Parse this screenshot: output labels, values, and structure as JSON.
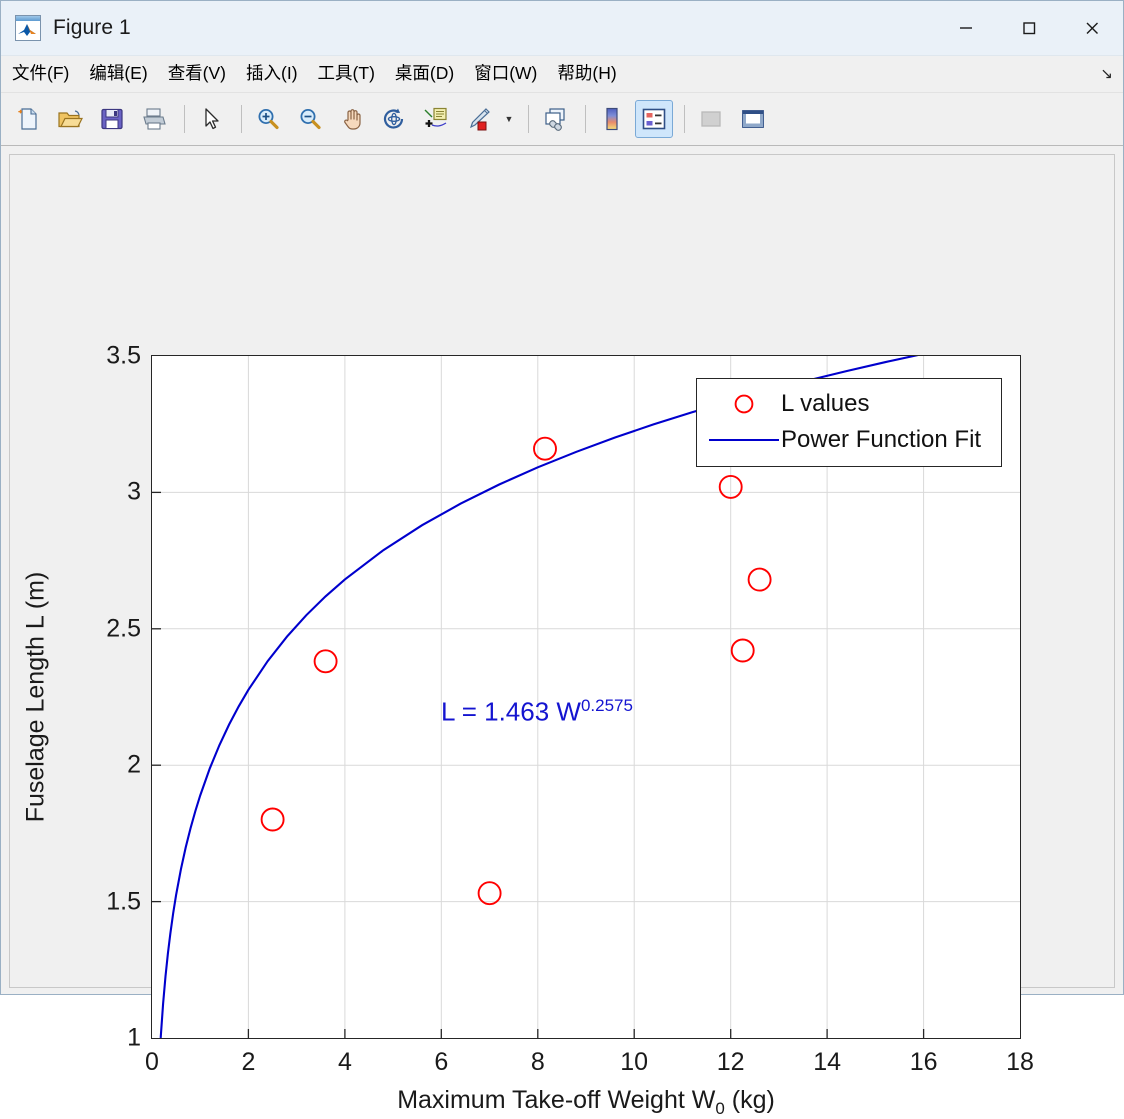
{
  "window": {
    "title": "Figure 1",
    "app_icon": "matlab-logo-icon",
    "minimize_label": "—",
    "maximize_label": "□",
    "close_label": "✕"
  },
  "menubar": {
    "items": [
      {
        "label": "文件(F)",
        "mnemonic": "F",
        "name": "menu-file"
      },
      {
        "label": "编辑(E)",
        "mnemonic": "E",
        "name": "menu-edit"
      },
      {
        "label": "查看(V)",
        "mnemonic": "V",
        "name": "menu-view"
      },
      {
        "label": "插入(I)",
        "mnemonic": "I",
        "name": "menu-insert"
      },
      {
        "label": "工具(T)",
        "mnemonic": "T",
        "name": "menu-tools"
      },
      {
        "label": "桌面(D)",
        "mnemonic": "D",
        "name": "menu-desktop"
      },
      {
        "label": "窗口(W)",
        "mnemonic": "W",
        "name": "menu-window"
      },
      {
        "label": "帮助(H)",
        "mnemonic": "H",
        "name": "menu-help"
      }
    ],
    "overflow_label": "↘"
  },
  "toolbar": {
    "buttons": [
      {
        "name": "new-figure-icon",
        "tooltip": "New Figure"
      },
      {
        "name": "open-file-icon",
        "tooltip": "Open File"
      },
      {
        "name": "save-figure-icon",
        "tooltip": "Save Figure"
      },
      {
        "name": "print-figure-icon",
        "tooltip": "Print Figure"
      },
      {
        "name": "pointer-icon",
        "tooltip": "Edit Plot"
      },
      {
        "name": "zoom-in-icon",
        "tooltip": "Zoom In"
      },
      {
        "name": "zoom-out-icon",
        "tooltip": "Zoom Out"
      },
      {
        "name": "pan-icon",
        "tooltip": "Pan"
      },
      {
        "name": "rotate-3d-icon",
        "tooltip": "Rotate 3D"
      },
      {
        "name": "data-cursor-icon",
        "tooltip": "Data Cursor"
      },
      {
        "name": "brush-icon",
        "tooltip": "Brush/Select Data"
      },
      {
        "name": "link-plot-icon",
        "tooltip": "Link Plot"
      },
      {
        "name": "colorbar-icon",
        "tooltip": "Insert Colorbar"
      },
      {
        "name": "legend-icon",
        "tooltip": "Insert Legend",
        "active": true
      },
      {
        "name": "hide-plot-tools-icon",
        "tooltip": "Hide Plot Tools",
        "disabled": true
      },
      {
        "name": "show-plot-tools-icon",
        "tooltip": "Show Plot Tools and Dock Figure"
      }
    ]
  },
  "chart_data": {
    "type": "scatter",
    "title": "",
    "xlabel": "Maximum Take-off Weight W_0 (kg)",
    "xlabel_main": "Maximum Take-off Weight W",
    "xlabel_sub": "0",
    "xlabel_unit": " (kg)",
    "ylabel": "Fuselage Length L (m)",
    "xlim": [
      0,
      18
    ],
    "ylim": [
      1,
      3.5
    ],
    "xticks": [
      0,
      2,
      4,
      6,
      8,
      10,
      12,
      14,
      16,
      18
    ],
    "yticks": [
      1,
      1.5,
      2,
      2.5,
      3,
      3.5
    ],
    "xtick_labels": [
      "0",
      "2",
      "4",
      "6",
      "8",
      "10",
      "12",
      "14",
      "16",
      "18"
    ],
    "ytick_labels": [
      "1",
      "1.5",
      "2",
      "2.5",
      "3",
      "3.5"
    ],
    "grid": true,
    "legend_position": "top-right",
    "series": [
      {
        "name": "L values",
        "type": "scatter",
        "marker": "circle-open",
        "color": "#ff0000",
        "points": [
          {
            "x": 2.5,
            "y": 1.8
          },
          {
            "x": 3.6,
            "y": 2.38
          },
          {
            "x": 7.0,
            "y": 1.53
          },
          {
            "x": 8.15,
            "y": 3.16
          },
          {
            "x": 12.0,
            "y": 3.02
          },
          {
            "x": 12.25,
            "y": 2.42
          },
          {
            "x": 12.6,
            "y": 2.68
          }
        ]
      },
      {
        "name": "Power Function Fit",
        "type": "line",
        "color": "#0000cd",
        "equation": "L = 1.463 * W^0.2575",
        "coefficient": 1.463,
        "exponent": 0.2575
      }
    ],
    "annotation": {
      "text": "L = 1.463 W^0.2575",
      "prefix": "L = 1.463 W",
      "exponent": "0.2575",
      "color": "#1414d0",
      "x": 6.0,
      "y": 2.22
    },
    "legend_entries": [
      {
        "label": "L values",
        "symbol": "circle-open",
        "color": "#ff0000"
      },
      {
        "label": "Power Function Fit",
        "symbol": "line",
        "color": "#0000cd"
      }
    ]
  },
  "colors": {
    "marker": "#ff0000",
    "fit_line": "#0000cd",
    "annotation": "#1414d0",
    "grid": "#d9d9d9",
    "axes": "#262626",
    "figure_bg": "#f0f0f0",
    "plot_bg": "#ffffff",
    "titlebar_bg": "#eaf1f8"
  }
}
